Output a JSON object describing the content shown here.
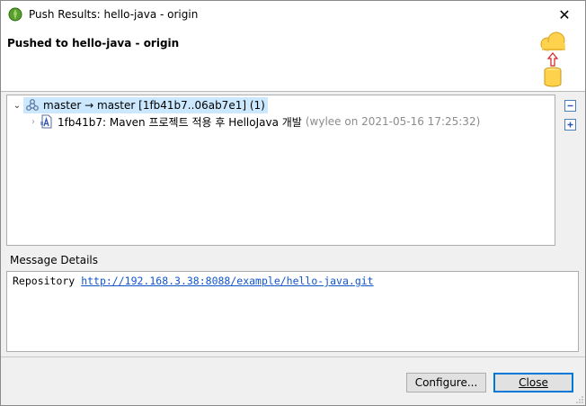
{
  "window": {
    "title": "Push Results: hello-java - origin",
    "close_symbol": "✕"
  },
  "banner": {
    "title": "Pushed to hello-java - origin",
    "graphic_icon": "push-to-cloud-icon"
  },
  "tree": {
    "ref_row": {
      "label": "master → master [1fb41b7..06ab7e1] (1)",
      "icon": "branch-icon",
      "expanded": true,
      "selected": true
    },
    "commit_row": {
      "label": "1fb41b7: Maven 프로젝트 적용 후 HelloJava 개발",
      "meta": "(wylee on 2021-05-16 17:25:32)",
      "icon": "commit-icon",
      "expanded": false
    },
    "collapse_all_icon": "collapse-all-icon",
    "expand_all_icon": "expand-all-icon"
  },
  "message_details": {
    "label": "Message Details",
    "prefix": "Repository",
    "link": "http://192.168.3.38:8088/example/hello-java.git"
  },
  "buttons": {
    "configure": "Configure...",
    "close": "Close"
  },
  "colors": {
    "selection": "#cce8ff",
    "link": "#1155cc",
    "default_button_border": "#0078d7"
  }
}
